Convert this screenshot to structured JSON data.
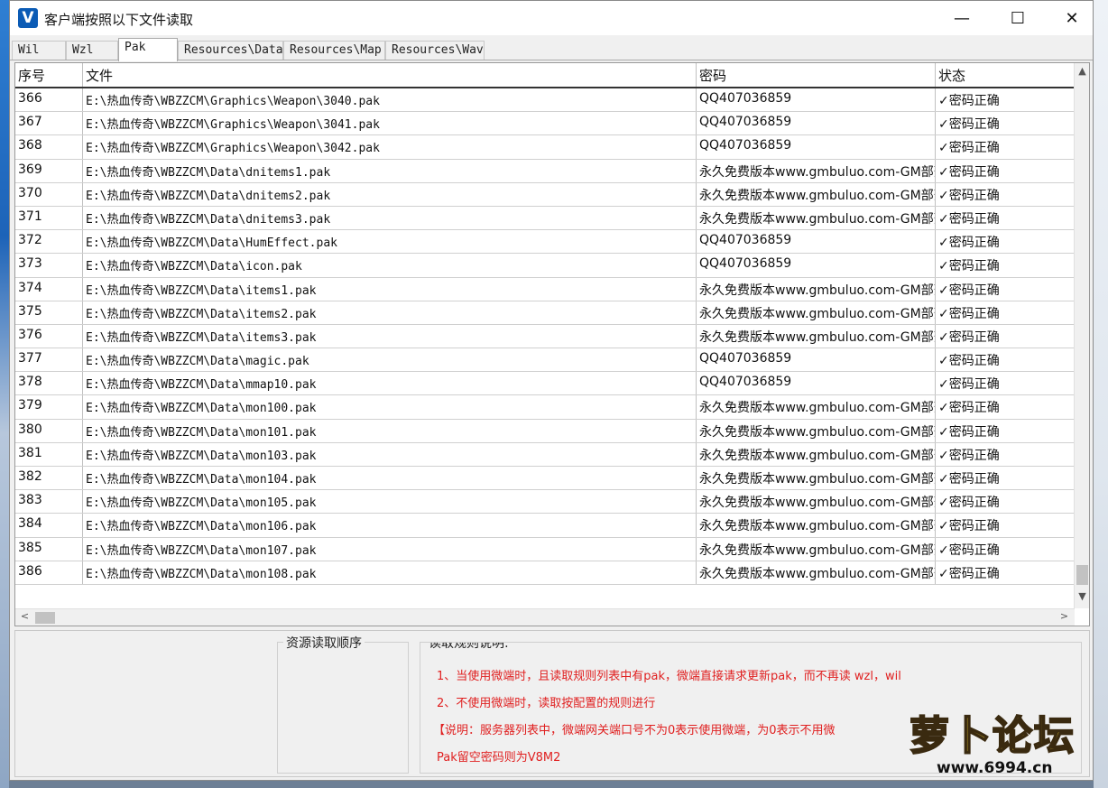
{
  "window": {
    "title": "客户端按照以下文件读取",
    "icon_letter": "V",
    "minimize": "—",
    "maximize": "☐",
    "close": "✕"
  },
  "tabs": [
    {
      "label": "Wil"
    },
    {
      "label": "Wzl"
    },
    {
      "label": "Pak"
    },
    {
      "label": "Resources\\Data"
    },
    {
      "label": "Resources\\Map"
    },
    {
      "label": "Resources\\Wav"
    }
  ],
  "active_tab": "Pak",
  "grid": {
    "headers": {
      "index": "序号",
      "file": "文件",
      "password": "密码",
      "status": "状态"
    },
    "rows": [
      [
        "366",
        "E:\\热血传奇\\WBZZCM\\Graphics\\Weapon\\3040.pak",
        "QQ407036859",
        "✓密码正确"
      ],
      [
        "367",
        "E:\\热血传奇\\WBZZCM\\Graphics\\Weapon\\3041.pak",
        "QQ407036859",
        "✓密码正确"
      ],
      [
        "368",
        "E:\\热血传奇\\WBZZCM\\Graphics\\Weapon\\3042.pak",
        "QQ407036859",
        "✓密码正确"
      ],
      [
        "369",
        "E:\\热血传奇\\WBZZCM\\Data\\dnitems1.pak",
        "永久免费版本www.gmbuluo.com-GM部落-",
        "✓密码正确"
      ],
      [
        "370",
        "E:\\热血传奇\\WBZZCM\\Data\\dnitems2.pak",
        "永久免费版本www.gmbuluo.com-GM部落-",
        "✓密码正确"
      ],
      [
        "371",
        "E:\\热血传奇\\WBZZCM\\Data\\dnitems3.pak",
        "永久免费版本www.gmbuluo.com-GM部落-",
        "✓密码正确"
      ],
      [
        "372",
        "E:\\热血传奇\\WBZZCM\\Data\\HumEffect.pak",
        "QQ407036859",
        "✓密码正确"
      ],
      [
        "373",
        "E:\\热血传奇\\WBZZCM\\Data\\icon.pak",
        "QQ407036859",
        "✓密码正确"
      ],
      [
        "374",
        "E:\\热血传奇\\WBZZCM\\Data\\items1.pak",
        "永久免费版本www.gmbuluo.com-GM部落-",
        "✓密码正确"
      ],
      [
        "375",
        "E:\\热血传奇\\WBZZCM\\Data\\items2.pak",
        "永久免费版本www.gmbuluo.com-GM部落-",
        "✓密码正确"
      ],
      [
        "376",
        "E:\\热血传奇\\WBZZCM\\Data\\items3.pak",
        "永久免费版本www.gmbuluo.com-GM部落-",
        "✓密码正确"
      ],
      [
        "377",
        "E:\\热血传奇\\WBZZCM\\Data\\magic.pak",
        "QQ407036859",
        "✓密码正确"
      ],
      [
        "378",
        "E:\\热血传奇\\WBZZCM\\Data\\mmap10.pak",
        "QQ407036859",
        "✓密码正确"
      ],
      [
        "379",
        "E:\\热血传奇\\WBZZCM\\Data\\mon100.pak",
        "永久免费版本www.gmbuluo.com-GM部落-",
        "✓密码正确"
      ],
      [
        "380",
        "E:\\热血传奇\\WBZZCM\\Data\\mon101.pak",
        "永久免费版本www.gmbuluo.com-GM部落-",
        "✓密码正确"
      ],
      [
        "381",
        "E:\\热血传奇\\WBZZCM\\Data\\mon103.pak",
        "永久免费版本www.gmbuluo.com-GM部落-",
        "✓密码正确"
      ],
      [
        "382",
        "E:\\热血传奇\\WBZZCM\\Data\\mon104.pak",
        "永久免费版本www.gmbuluo.com-GM部落-",
        "✓密码正确"
      ],
      [
        "383",
        "E:\\热血传奇\\WBZZCM\\Data\\mon105.pak",
        "永久免费版本www.gmbuluo.com-GM部落-",
        "✓密码正确"
      ],
      [
        "384",
        "E:\\热血传奇\\WBZZCM\\Data\\mon106.pak",
        "永久免费版本www.gmbuluo.com-GM部落-",
        "✓密码正确"
      ],
      [
        "385",
        "E:\\热血传奇\\WBZZCM\\Data\\mon107.pak",
        "永久免费版本www.gmbuluo.com-GM部落-",
        "✓密码正确"
      ],
      [
        "386",
        "E:\\热血传奇\\WBZZCM\\Data\\mon108.pak",
        "永久免费版本www.gmbuluo.com-GM部落-",
        "✓密码正确"
      ]
    ]
  },
  "scroll": {
    "up": "▲",
    "down": "▼",
    "left": "<",
    "right": ">"
  },
  "bottom": {
    "order_title": "资源读取顺序",
    "rules_title": "读取规则说明:",
    "rules": [
      "1、当使用微端时，且读取规则列表中有pak，微端直接请求更新pak，而不再读 wzl，wil",
      "2、不使用微端时，读取按配置的规则进行",
      "【说明：服务器列表中，微端网关端口号不为0表示使用微端，为0表示不用微",
      "Pak留空密码则为V8M2"
    ]
  },
  "watermark": {
    "text": "萝卜论坛",
    "url": "www.6994.cn"
  },
  "colors": {
    "rule_text": "#e02020",
    "grid_border": "#c0c0c0"
  }
}
